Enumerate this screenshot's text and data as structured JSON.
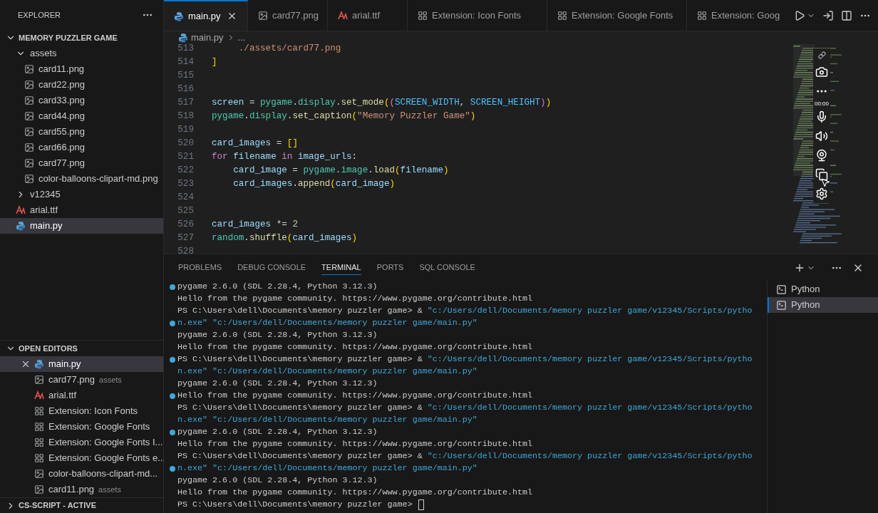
{
  "sidebar": {
    "title": "EXPLORER",
    "explorer": {
      "label": "MEMORY PUZZLER GAME",
      "expanded": true,
      "children": [
        {
          "name": "assets",
          "kind": "folder",
          "expanded": true,
          "selected": false,
          "children": [
            {
              "name": "card11.png",
              "kind": "image",
              "selected": false
            },
            {
              "name": "card22.png",
              "kind": "image",
              "selected": false
            },
            {
              "name": "card33.png",
              "kind": "image",
              "selected": false
            },
            {
              "name": "card44.png",
              "kind": "image",
              "selected": false
            },
            {
              "name": "card55.png",
              "kind": "image",
              "selected": false
            },
            {
              "name": "card66.png",
              "kind": "image",
              "selected": false
            },
            {
              "name": "card77.png",
              "kind": "image",
              "selected": false
            },
            {
              "name": "color-balloons-clipart-md.png",
              "kind": "image",
              "selected": false
            }
          ]
        },
        {
          "name": "v12345",
          "kind": "folder",
          "expanded": false,
          "selected": false
        },
        {
          "name": "arial.ttf",
          "kind": "font",
          "selected": false
        },
        {
          "name": "main.py",
          "kind": "python",
          "selected": true
        }
      ]
    },
    "open_editors": {
      "label": "OPEN EDITORS",
      "expanded": true,
      "items": [
        {
          "name": "main.py",
          "kind": "python",
          "selected": true
        },
        {
          "name": "card77.png",
          "kind": "image",
          "description": "assets",
          "selected": false
        },
        {
          "name": "arial.ttf",
          "kind": "font",
          "selected": false
        },
        {
          "name": "Extension: Icon Fonts",
          "kind": "extension",
          "selected": false
        },
        {
          "name": "Extension: Google Fonts",
          "kind": "extension",
          "selected": false
        },
        {
          "name": "Extension: Google Fonts I...",
          "kind": "extension",
          "selected": false
        },
        {
          "name": "Extension: Google Fonts e...",
          "kind": "extension",
          "selected": false
        },
        {
          "name": "color-balloons-clipart-md...",
          "kind": "image",
          "selected": false
        },
        {
          "name": "card11.png",
          "kind": "image",
          "description": "assets",
          "selected": false
        }
      ]
    },
    "bottom_section": {
      "label": "CS-SCRIPT - ACTIVE",
      "expanded": false
    }
  },
  "tabs": [
    {
      "label": "main.py",
      "kind": "python",
      "selected": true
    },
    {
      "label": "card77.png",
      "kind": "image",
      "selected": false
    },
    {
      "label": "arial.ttf",
      "kind": "font",
      "selected": false
    },
    {
      "label": "Extension: Icon Fonts",
      "kind": "extension",
      "selected": false
    },
    {
      "label": "Extension: Google Fonts",
      "kind": "extension",
      "selected": false
    },
    {
      "label": "Extension: Goog",
      "kind": "extension",
      "selected": false
    }
  ],
  "breadcrumb": [
    "main.py",
    "..."
  ],
  "code": [
    {
      "number": "513",
      "tokens": [
        {
          "text": "     ./assets/card77.png",
          "kind": "string"
        }
      ]
    },
    {
      "number": "514",
      "tokens": [
        {
          "text": "]",
          "kind": "bracket"
        }
      ]
    },
    {
      "number": "515"
    },
    {
      "number": "516"
    },
    {
      "number": "517",
      "tokens": [
        {
          "text": "screen",
          "kind": "variable"
        },
        {
          "text": " = ",
          "kind": "plain"
        },
        {
          "text": "pygame",
          "kind": "module"
        },
        {
          "text": ".",
          "kind": "plain"
        },
        {
          "text": "display",
          "kind": "module"
        },
        {
          "text": ".",
          "kind": "plain"
        },
        {
          "text": "set_mode",
          "kind": "function"
        },
        {
          "text": "(",
          "kind": "bracket"
        },
        {
          "text": "(",
          "kind": "bracket2"
        },
        {
          "text": "SCREEN_WIDTH",
          "kind": "constant"
        },
        {
          "text": ", ",
          "kind": "plain"
        },
        {
          "text": "SCREEN_HEIGHT",
          "kind": "constant"
        },
        {
          "text": ")",
          "kind": "bracket2"
        },
        {
          "text": ")",
          "kind": "bracket"
        }
      ]
    },
    {
      "number": "518",
      "tokens": [
        {
          "text": "pygame",
          "kind": "module"
        },
        {
          "text": ".",
          "kind": "plain"
        },
        {
          "text": "display",
          "kind": "module"
        },
        {
          "text": ".",
          "kind": "plain"
        },
        {
          "text": "set_caption",
          "kind": "function"
        },
        {
          "text": "(",
          "kind": "bracket"
        },
        {
          "text": "\"Memory Puzzler Game\"",
          "kind": "string"
        },
        {
          "text": ")",
          "kind": "bracket"
        }
      ]
    },
    {
      "number": "519"
    },
    {
      "number": "520",
      "tokens": [
        {
          "text": "card_images",
          "kind": "variable"
        },
        {
          "text": " = ",
          "kind": "plain"
        },
        {
          "text": "[]",
          "kind": "bracket"
        }
      ]
    },
    {
      "number": "521",
      "tokens": [
        {
          "text": "for ",
          "kind": "keyword"
        },
        {
          "text": "filename",
          "kind": "variable"
        },
        {
          "text": " in ",
          "kind": "keyword"
        },
        {
          "text": "image_urls",
          "kind": "variable"
        },
        {
          "text": ":",
          "kind": "plain"
        }
      ]
    },
    {
      "number": "522",
      "tokens": [
        {
          "text": "    card_image",
          "kind": "variable"
        },
        {
          "text": " = ",
          "kind": "plain"
        },
        {
          "text": "pygame",
          "kind": "module"
        },
        {
          "text": ".",
          "kind": "plain"
        },
        {
          "text": "image",
          "kind": "module"
        },
        {
          "text": ".",
          "kind": "plain"
        },
        {
          "text": "load",
          "kind": "function"
        },
        {
          "text": "(",
          "kind": "bracket"
        },
        {
          "text": "filename",
          "kind": "variable"
        },
        {
          "text": ")",
          "kind": "bracket"
        }
      ]
    },
    {
      "number": "523",
      "tokens": [
        {
          "text": "    card_images",
          "kind": "variable"
        },
        {
          "text": ".",
          "kind": "plain"
        },
        {
          "text": "append",
          "kind": "function"
        },
        {
          "text": "(",
          "kind": "bracket"
        },
        {
          "text": "card_image",
          "kind": "variable"
        },
        {
          "text": ")",
          "kind": "bracket"
        }
      ]
    },
    {
      "number": "524"
    },
    {
      "number": "525"
    },
    {
      "number": "526",
      "tokens": [
        {
          "text": "card_images",
          "kind": "variable"
        },
        {
          "text": " *= ",
          "kind": "plain"
        },
        {
          "text": "2",
          "kind": "number"
        }
      ]
    },
    {
      "number": "527",
      "tokens": [
        {
          "text": "random",
          "kind": "module"
        },
        {
          "text": ".",
          "kind": "plain"
        },
        {
          "text": "shuffle",
          "kind": "function"
        },
        {
          "text": "(",
          "kind": "bracket"
        },
        {
          "text": "card_images",
          "kind": "variable"
        },
        {
          "text": ")",
          "kind": "bracket"
        }
      ]
    },
    {
      "number": "528"
    }
  ],
  "recorder": {
    "timer": "00:00"
  },
  "panel_tabs": [
    {
      "label": "PROBLEMS",
      "selected": false
    },
    {
      "label": "DEBUG CONSOLE",
      "selected": false
    },
    {
      "label": "TERMINAL",
      "selected": true
    },
    {
      "label": "PORTS",
      "selected": false
    },
    {
      "label": "SQL CONSOLE",
      "selected": false
    }
  ],
  "terminal": [
    {
      "dot": true,
      "cursor": false,
      "tokens": [
        {
          "text": "pygame 2.6.0 (SDL 2.28.4, Python 3.12.3)",
          "kind": "plain"
        }
      ]
    },
    {
      "dot": false,
      "cursor": false,
      "tokens": [
        {
          "text": "Hello from the pygame community. https://www.pygame.org/contribute.html",
          "kind": "plain"
        }
      ]
    },
    {
      "dot": false,
      "cursor": false,
      "tokens": [
        {
          "text": "PS C:\\Users\\dell\\Documents\\memory puzzler game> & ",
          "kind": "plain"
        },
        {
          "text": "\"c:/Users/dell/Documents/memory puzzler game/v12345/Scripts/pytho",
          "kind": "path"
        }
      ]
    },
    {
      "dot": true,
      "cursor": false,
      "tokens": [
        {
          "text": "n.exe\" \"c:/Users/dell/Documents/memory puzzler game/main.py\"",
          "kind": "path"
        }
      ]
    },
    {
      "dot": false,
      "cursor": false,
      "tokens": [
        {
          "text": "pygame 2.6.0 (SDL 2.28.4, Python 3.12.3)",
          "kind": "plain"
        }
      ]
    },
    {
      "dot": false,
      "cursor": false,
      "tokens": [
        {
          "text": "Hello from the pygame community. https://www.pygame.org/contribute.html",
          "kind": "plain"
        }
      ]
    },
    {
      "dot": true,
      "cursor": false,
      "tokens": [
        {
          "text": "PS C:\\Users\\dell\\Documents\\memory puzzler game> & ",
          "kind": "plain"
        },
        {
          "text": "\"c:/Users/dell/Documents/memory puzzler game/v12345/Scripts/pytho",
          "kind": "path"
        }
      ]
    },
    {
      "dot": false,
      "cursor": false,
      "tokens": [
        {
          "text": "n.exe\" \"c:/Users/dell/Documents/memory puzzler game/main.py\"",
          "kind": "path"
        }
      ]
    },
    {
      "dot": false,
      "cursor": false,
      "tokens": [
        {
          "text": "pygame 2.6.0 (SDL 2.28.4, Python 3.12.3)",
          "kind": "plain"
        }
      ]
    },
    {
      "dot": true,
      "cursor": false,
      "tokens": [
        {
          "text": "Hello from the pygame community. https://www.pygame.org/contribute.html",
          "kind": "plain"
        }
      ]
    },
    {
      "dot": false,
      "cursor": false,
      "tokens": [
        {
          "text": "PS C:\\Users\\dell\\Documents\\memory puzzler game> & ",
          "kind": "plain"
        },
        {
          "text": "\"c:/Users/dell/Documents/memory puzzler game/v12345/Scripts/pytho",
          "kind": "path"
        }
      ]
    },
    {
      "dot": false,
      "cursor": false,
      "tokens": [
        {
          "text": "n.exe\" \"c:/Users/dell/Documents/memory puzzler game/main.py\"",
          "kind": "path"
        }
      ]
    },
    {
      "dot": true,
      "cursor": false,
      "tokens": [
        {
          "text": "pygame 2.6.0 (SDL 2.28.4, Python 3.12.3)",
          "kind": "plain"
        }
      ]
    },
    {
      "dot": false,
      "cursor": false,
      "tokens": [
        {
          "text": "Hello from the pygame community. https://www.pygame.org/contribute.html",
          "kind": "plain"
        }
      ]
    },
    {
      "dot": false,
      "cursor": false,
      "tokens": [
        {
          "text": "PS C:\\Users\\dell\\Documents\\memory puzzler game> & ",
          "kind": "plain"
        },
        {
          "text": "\"c:/Users/dell/Documents/memory puzzler game/v12345/Scripts/pytho",
          "kind": "path"
        }
      ]
    },
    {
      "dot": true,
      "cursor": false,
      "tokens": [
        {
          "text": "n.exe\" \"c:/Users/dell/Documents/memory puzzler game/main.py\"",
          "kind": "path"
        }
      ]
    },
    {
      "dot": false,
      "cursor": false,
      "tokens": [
        {
          "text": "pygame 2.6.0 (SDL 2.28.4, Python 3.12.3)",
          "kind": "plain"
        }
      ]
    },
    {
      "dot": false,
      "cursor": false,
      "tokens": [
        {
          "text": "Hello from the pygame community. https://www.pygame.org/contribute.html",
          "kind": "plain"
        }
      ]
    },
    {
      "dot": false,
      "cursor": true,
      "tokens": [
        {
          "text": "PS C:\\Users\\dell\\Documents\\memory puzzler game> ",
          "kind": "plain"
        }
      ]
    }
  ],
  "terminal_list": [
    {
      "label": "Python",
      "selected": false
    },
    {
      "label": "Python",
      "selected": true
    }
  ]
}
